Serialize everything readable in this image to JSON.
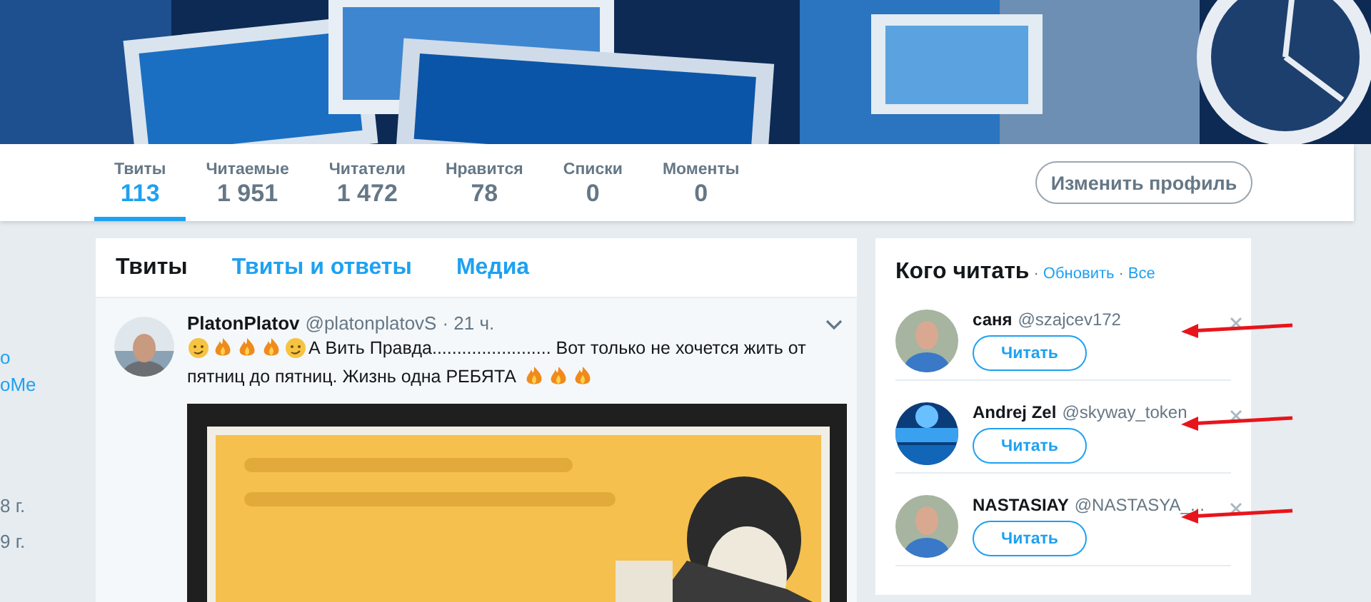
{
  "stats": [
    {
      "label": "Твиты",
      "value": "113",
      "selected": true
    },
    {
      "label": "Читаемые",
      "value": "1 951",
      "selected": false
    },
    {
      "label": "Читатели",
      "value": "1 472",
      "selected": false
    },
    {
      "label": "Нравится",
      "value": "78",
      "selected": false
    },
    {
      "label": "Списки",
      "value": "0",
      "selected": false
    },
    {
      "label": "Моменты",
      "value": "0",
      "selected": false
    }
  ],
  "edit_profile_button": "Изменить профиль",
  "sidebar_fragments": [
    {
      "text": "о",
      "kind": "link"
    },
    {
      "text": "оMe",
      "kind": "link"
    },
    {
      "text": "8 г.",
      "kind": "date"
    },
    {
      "text": "9 г.",
      "kind": "date"
    }
  ],
  "timeline_tabs": [
    {
      "label": "Твиты",
      "selected": true
    },
    {
      "label": "Твиты и ответы",
      "selected": false
    },
    {
      "label": "Медиа",
      "selected": false
    }
  ],
  "tweet": {
    "name": "PlatonPlatov",
    "handle": "@platonplatovS",
    "time": "· 21 ч.",
    "text_lines": [
      "А Вить Правда........................ Вот только не хочется жить от",
      "пятниц до пятниц. Жизнь одна РЕБЯТА"
    ],
    "media": {
      "kind": "picture"
    }
  },
  "who_to_follow": {
    "title": "Кого читать",
    "links": [
      {
        "sep": "·",
        "label": "Обновить"
      },
      {
        "sep": "·",
        "label": "Все"
      }
    ],
    "accounts": [
      {
        "name": "саня",
        "handle": "@szajcev172",
        "button": "Читать",
        "annotation_arrow": true
      },
      {
        "name": "Andrej Zel",
        "handle": "@skyway_token",
        "button": "Читать",
        "annotation_arrow": true
      },
      {
        "name": "NASTASIAY",
        "handle": "@NASTASYA_...",
        "button": "Читать",
        "annotation_arrow": true
      }
    ]
  }
}
